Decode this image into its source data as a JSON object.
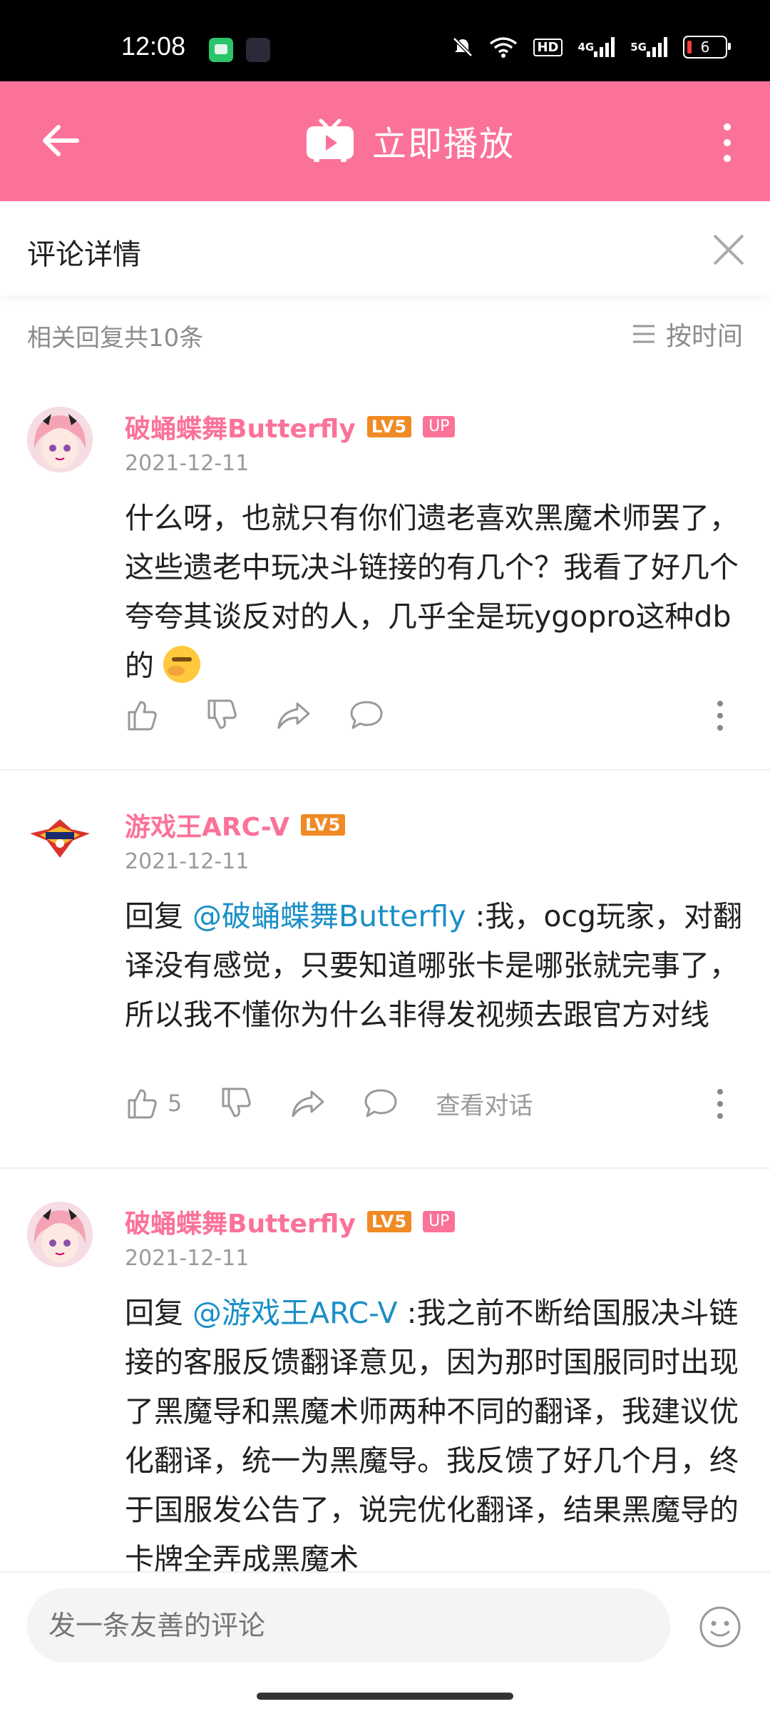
{
  "status_bar": {
    "time": "12:08",
    "hd_label": "HD",
    "net1": "4G",
    "net2": "5G",
    "battery_level": "6"
  },
  "app_bar": {
    "title": "立即播放",
    "color": "#fb7299"
  },
  "detail": {
    "title": "评论详情",
    "replies_count": "相关回复共10条",
    "sort_label": "按时间"
  },
  "comments": [
    {
      "username": "破蛹蝶舞Butterfly",
      "level": "LV5",
      "badge": "UP",
      "date": "2021-12-11",
      "text": "什么呀，也就只有你们遗老喜欢黑魔术师罢了，这些遗老中玩决斗链接的有几个？我看了好几个夸夸其谈反对的人，几乎全是玩ygopro这种db的",
      "like_count": ""
    },
    {
      "username": "游戏王ARC-V",
      "level": "LV5",
      "date": "2021-12-11",
      "reply_prefix": "回复 ",
      "mention": "@破蛹蝶舞Butterfly",
      "text": " :我，ocg玩家，对翻译没有感觉，只要知道哪张卡是哪张就完事了，所以我不懂你为什么非得发视频去跟官方对线",
      "like_count": "5",
      "view_conversation": "查看对话"
    },
    {
      "username": "破蛹蝶舞Butterfly",
      "level": "LV5",
      "badge": "UP",
      "date": "2021-12-11",
      "reply_prefix": "回复 ",
      "mention": "@游戏王ARC-V",
      "text": " :我之前不断给国服决斗链接的客服反馈翻译意见，因为那时国服同时出现了黑魔导和黑魔术师两种不同的翻译，我建议优化翻译，统一为黑魔导。我反馈了好几个月，终于国服发公告了，说完优化翻译，结果黑魔导的卡牌全弄成黑魔术"
    }
  ],
  "input": {
    "placeholder": "发一条友善的评论"
  }
}
